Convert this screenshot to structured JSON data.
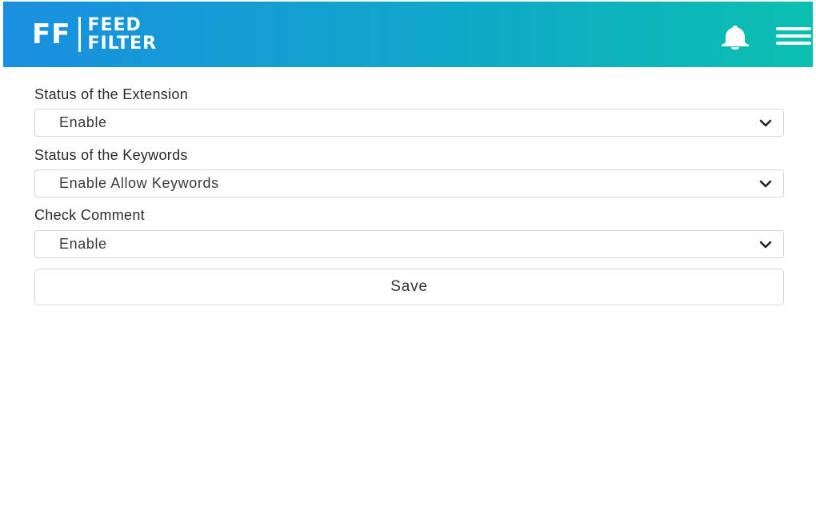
{
  "header": {
    "logo_initials": "FF",
    "logo_word1": "FEED",
    "logo_word2": "FILTER",
    "icons": [
      "bell-icon",
      "hamburger-menu-icon"
    ]
  },
  "form": {
    "extension_status": {
      "label": "Status of the Extension",
      "value": "Enable"
    },
    "keywords_status": {
      "label": "Status of the Keywords",
      "value": "Enable Allow Keywords"
    },
    "check_comment": {
      "label": "Check Comment",
      "value": "Enable"
    },
    "save_label": "Save"
  },
  "colors": {
    "header_gradient_start": "#1a8fe0",
    "header_gradient_end": "#0bbfb0",
    "border": "#d6d6d6"
  }
}
